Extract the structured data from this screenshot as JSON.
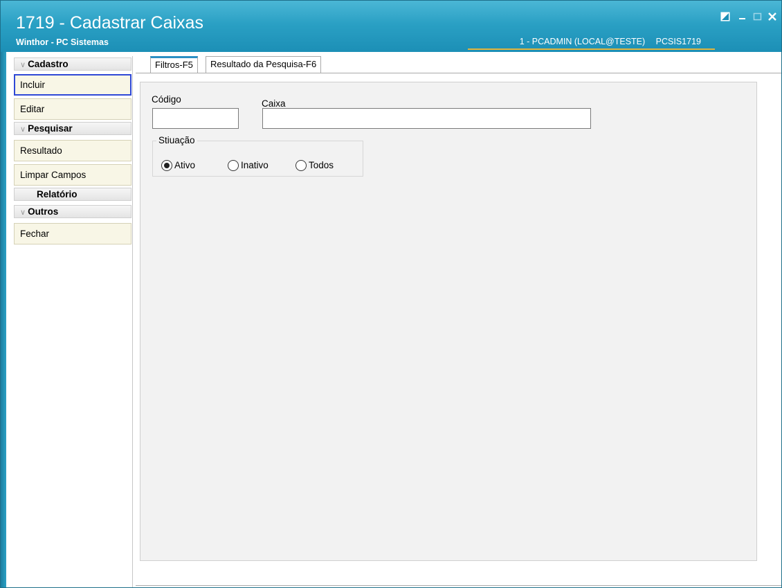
{
  "window": {
    "title": "1719 - Cadastrar Caixas",
    "subtitle": "Winthor - PC Sistemas",
    "user": "1 - PCADMIN (LOCAL@TESTE)",
    "routine": "PCSIS1719"
  },
  "sidebar": {
    "groups": {
      "cadastro": "Cadastro",
      "pesquisar": "Pesquisar",
      "relatorio": "Relatório",
      "outros": "Outros"
    },
    "buttons": {
      "incluir": "Incluir",
      "editar": "Editar",
      "resultado": "Resultado",
      "limpar": "Limpar Campos",
      "fechar": "Fechar"
    }
  },
  "tabs": {
    "filtros": "Filtros-F5",
    "resultado": "Resultado da Pesquisa-F6"
  },
  "filters": {
    "codigo_label": "Código",
    "codigo_value": "",
    "caixa_label": "Caixa",
    "caixa_value": "",
    "situacao_label": "Stiuação",
    "options": {
      "ativo": "Ativo",
      "inativo": "Inativo",
      "todos": "Todos"
    },
    "selected": "Ativo"
  },
  "colors": {
    "titlebar": "#2aa0c4",
    "focus_border": "#2e48d6",
    "user_underline": "#e2b53c"
  }
}
